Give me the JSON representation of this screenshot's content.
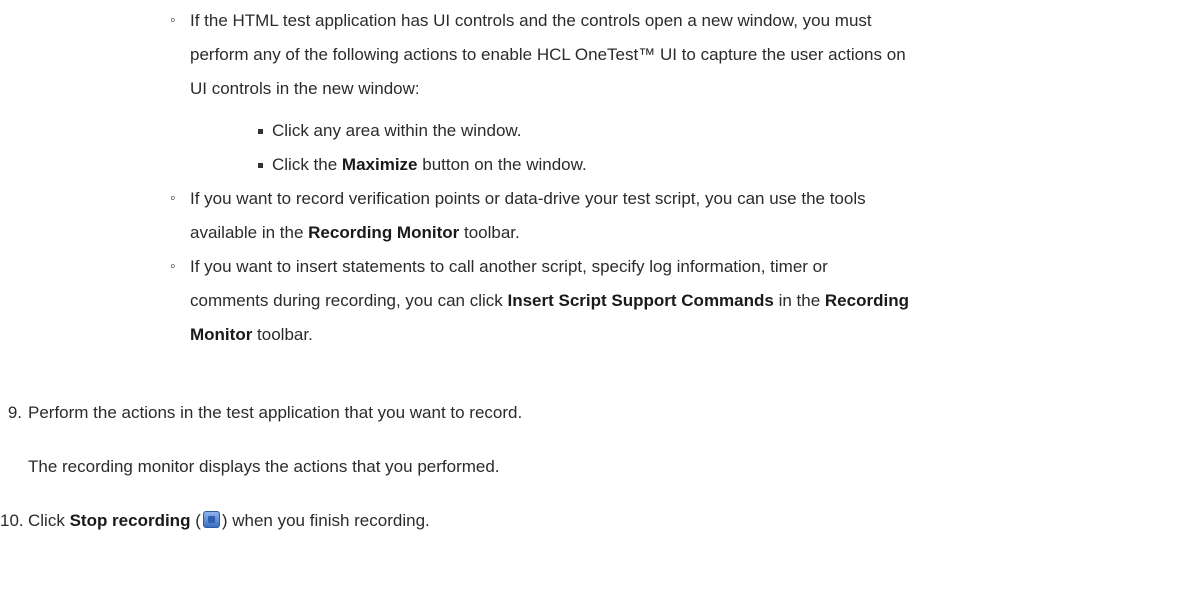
{
  "sub_items": [
    {
      "lines": [
        "If the HTML test application has UI controls and the controls open a new window, you must",
        "perform any of the following actions to enable HCL OneTest™ UI to capture the user actions on",
        "UI controls in the new window:"
      ],
      "nested": [
        {
          "text": "Click any area within the window."
        },
        {
          "pre": "Click the ",
          "bold": "Maximize",
          "post": " button on the window."
        }
      ]
    },
    {
      "line1": "If you want to record verification points or data-drive your test script, you can use the tools",
      "line2_pre": "available in the ",
      "line2_bold": "Recording Monitor",
      "line2_post": " toolbar."
    },
    {
      "line1": "If you want to insert statements to call another script, specify log information, timer or",
      "line2_pre": "comments during recording, you can click ",
      "line2_bold1": "Insert Script Support Commands",
      "line2_mid": " in the ",
      "line2_bold2": "Recording",
      "line3_bold": "Monitor",
      "line3_post": " toolbar."
    }
  ],
  "steps": [
    {
      "number": "9.",
      "text": "Perform the actions in the test application that you want to record.",
      "result": "The recording monitor displays the actions that you performed."
    },
    {
      "number": "10.",
      "pre": "Click ",
      "bold": "Stop recording",
      "open_paren": " (",
      "icon": "stop-recording-icon",
      "close_paren": ") when you finish recording."
    }
  ]
}
